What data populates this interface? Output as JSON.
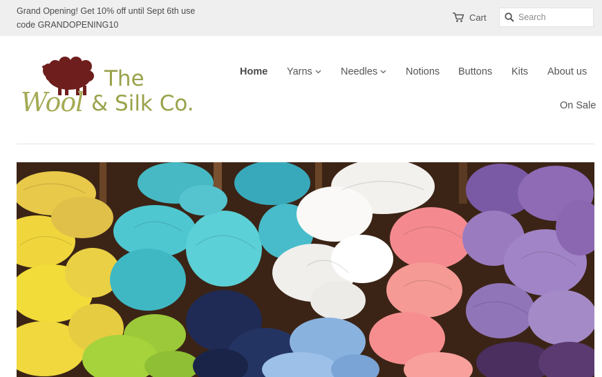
{
  "announcement": {
    "line1": "Grand Opening! Get 10% off until Sept 6th use",
    "line2": "code GRANDOPENING10"
  },
  "header": {
    "cart_label": "Cart",
    "cart_icon": "cart-icon",
    "search_placeholder": "Search",
    "search_icon": "search-icon"
  },
  "logo": {
    "word_the": "The",
    "word_wool": "Wool",
    "word_silk": "& Silk Co."
  },
  "nav": {
    "home": "Home",
    "yarns": "Yarns",
    "needles": "Needles",
    "notions": "Notions",
    "buttons": "Buttons",
    "kits": "Kits",
    "about": "About us",
    "sale": "On Sale"
  },
  "colors": {
    "brand_green": "#9aa24a",
    "sheep_maroon": "#6e1e1c",
    "topbar_bg": "#efefef"
  }
}
